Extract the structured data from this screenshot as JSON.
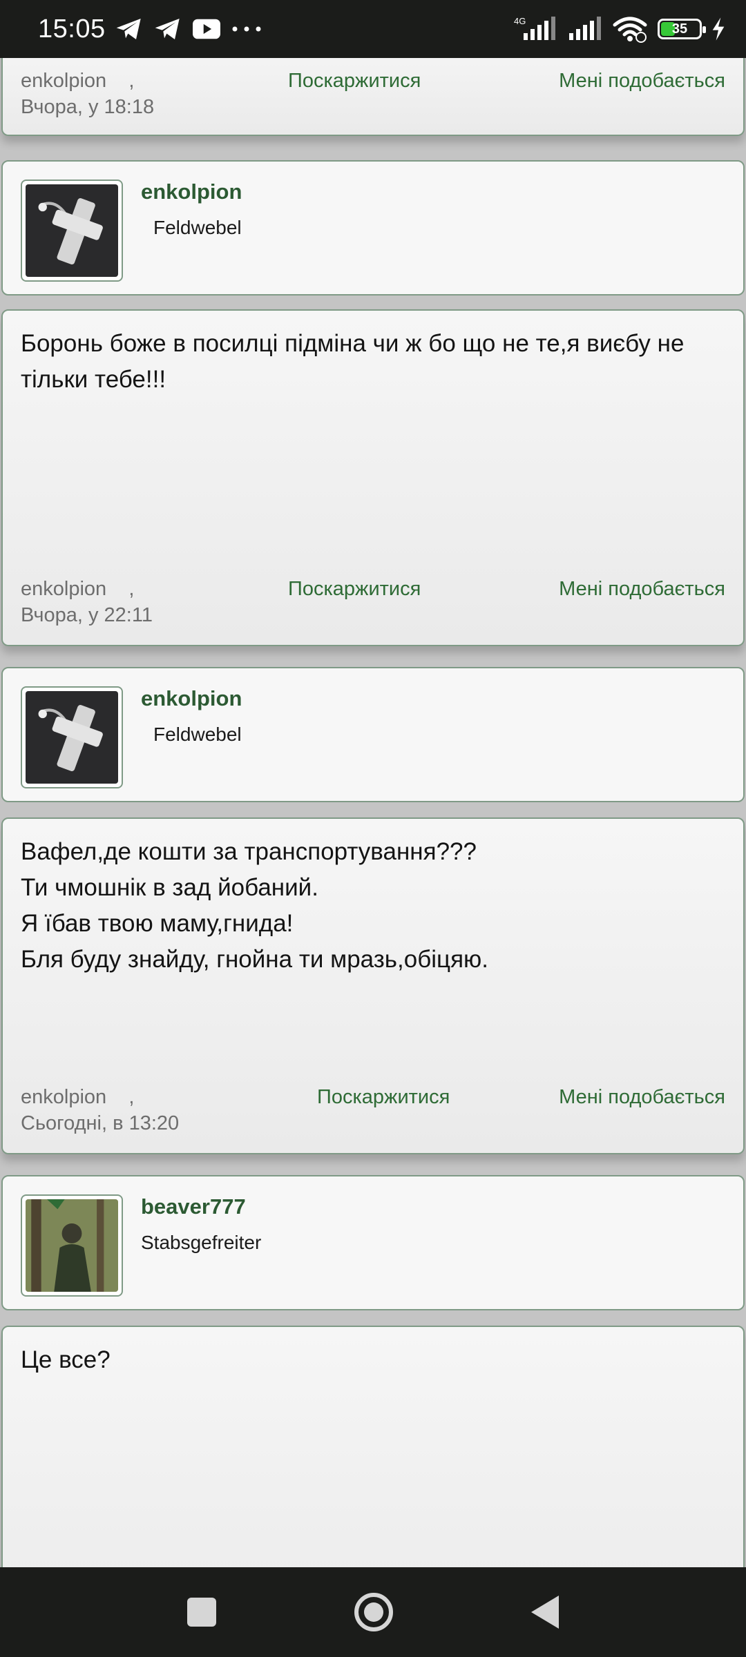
{
  "status_bar": {
    "time": "15:05",
    "network_label": "4G",
    "battery": "35",
    "battery_level": 0.35
  },
  "posts": [
    {
      "meta_author": "enkolpion",
      "meta_separator": ",",
      "meta_time": "Вчора, у 18:18",
      "report_label": "Поскаржитися",
      "like_label": "Мені подобається"
    },
    {
      "author": "enkolpion",
      "rank": "Feldwebel",
      "body": "Боронь боже в посилці підміна чи ж бо що не те,я виєбу не тільки тебе!!!",
      "meta_author": "enkolpion",
      "meta_separator": ",",
      "meta_time": "Вчора, у 22:11",
      "report_label": "Поскаржитися",
      "like_label": "Мені подобається"
    },
    {
      "author": "enkolpion",
      "rank": "Feldwebel",
      "body_lines": [
        "Вафел,де кошти за транспортування???",
        "Ти чмошнік в зад йобаний.",
        "Я їбав твою маму,гнида!",
        "Бля буду знайду, гнойна ти мразь,обіцяю."
      ],
      "meta_author": "enkolpion",
      "meta_separator": ",",
      "meta_time": "Сьогодні, в 13:20",
      "report_label": "Поскаржитися",
      "like_label": "Мені подобається"
    },
    {
      "author": "beaver777",
      "rank": "Stabsgefreiter",
      "body": "Це все?"
    }
  ],
  "colors": {
    "accent_green": "#2c5a33",
    "link_green": "#2e6b35",
    "card_border": "#7f9a86",
    "page_bg": "#c4c4c4",
    "system_bar": "#1b1c1a"
  }
}
